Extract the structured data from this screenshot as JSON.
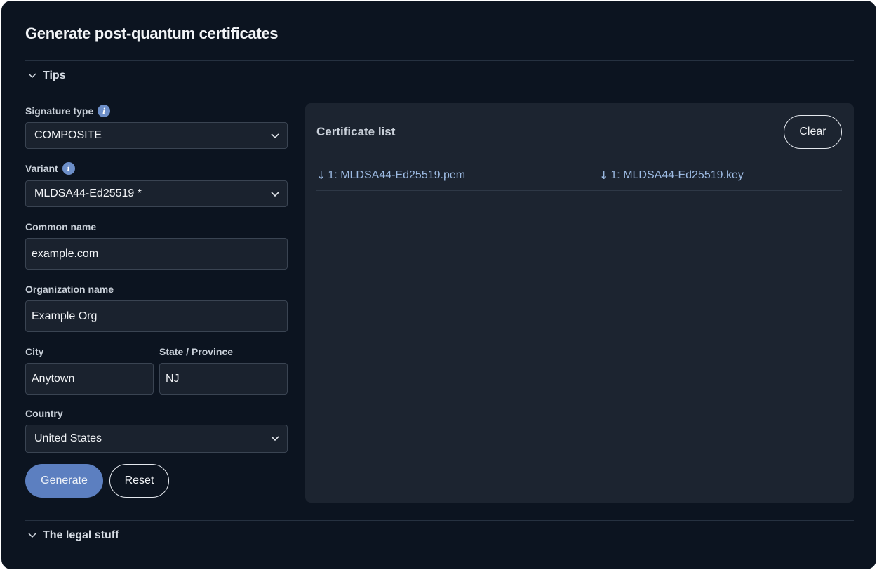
{
  "page": {
    "title": "Generate post-quantum certificates"
  },
  "sections": {
    "tips_label": "Tips",
    "legal_label": "The legal stuff"
  },
  "form": {
    "signature_type": {
      "label": "Signature type",
      "value": "COMPOSITE",
      "info_icon": "info-icon"
    },
    "variant": {
      "label": "Variant",
      "value": "MLDSA44-Ed25519 *",
      "info_icon": "info-icon"
    },
    "common_name": {
      "label": "Common name",
      "value": "example.com"
    },
    "organization_name": {
      "label": "Organization name",
      "value": "Example Org"
    },
    "city": {
      "label": "City",
      "value": "Anytown"
    },
    "state": {
      "label": "State / Province",
      "value": "NJ"
    },
    "country": {
      "label": "Country",
      "value": "United States"
    },
    "generate_label": "Generate",
    "reset_label": "Reset"
  },
  "certificates": {
    "title": "Certificate list",
    "clear_label": "Clear",
    "items": [
      {
        "pem": "1: MLDSA44-Ed25519.pem",
        "key": "1: MLDSA44-Ed25519.key"
      }
    ]
  },
  "colors": {
    "background": "#0c1420",
    "panel": "#1c2430",
    "accent": "#5c7fc0",
    "link": "#9dbbe3"
  },
  "icons": {
    "collapse": "chevron-down-icon",
    "select": "chevron-down-icon",
    "download": "download-arrow-icon"
  }
}
